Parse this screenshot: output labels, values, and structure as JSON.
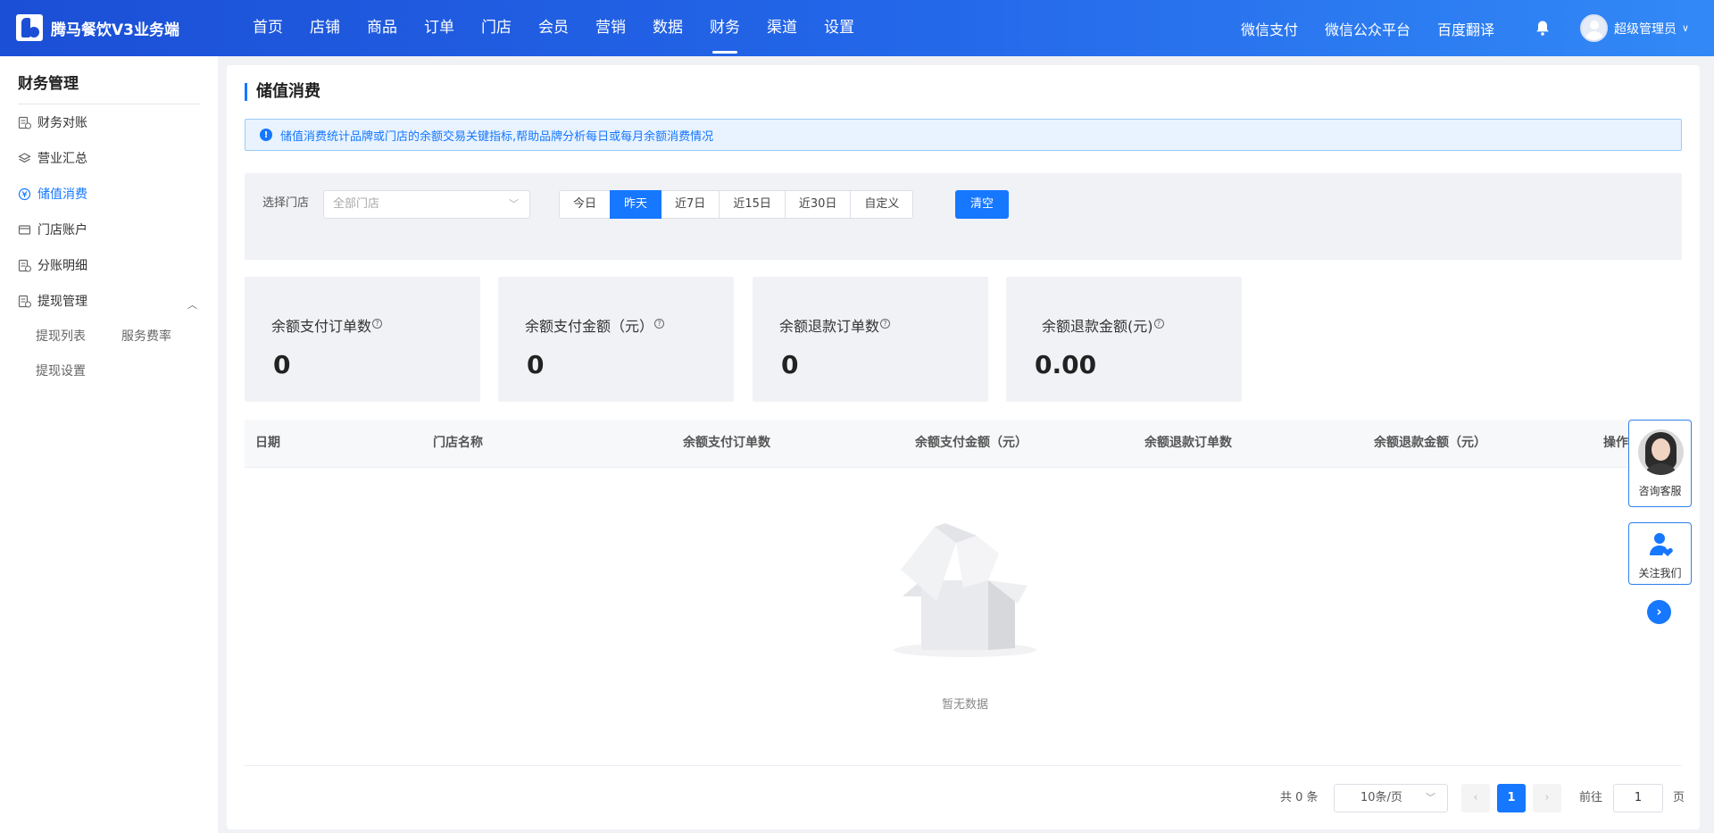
{
  "header": {
    "app_title": "腾马餐饮V3业务端",
    "nav": [
      "首页",
      "店铺",
      "商品",
      "订单",
      "门店",
      "会员",
      "营销",
      "数据",
      "财务",
      "渠道",
      "设置"
    ],
    "active_nav": "财务",
    "right_links": [
      "微信支付",
      "微信公众平台",
      "百度翻译"
    ],
    "user_name": "超级管理员",
    "user_caret": "∨"
  },
  "sidebar": {
    "title": "财务管理",
    "items": [
      {
        "label": "财务对账",
        "icon": "ledger-icon"
      },
      {
        "label": "营业汇总",
        "icon": "layers-icon"
      },
      {
        "label": "储值消费",
        "icon": "stored-value-icon",
        "active": true
      },
      {
        "label": "门店账户",
        "icon": "card-icon"
      },
      {
        "label": "分账明细",
        "icon": "ledger-icon"
      },
      {
        "label": "提现管理",
        "icon": "ledger-icon",
        "expanded": true
      }
    ],
    "sub_items": [
      "提现列表",
      "服务费率",
      "提现设置"
    ],
    "collapse_caret": "︿"
  },
  "page": {
    "title": "储值消费",
    "notice_icon": "!",
    "notice": "储值消费统计品牌或门店的余额交易关键指标,帮助品牌分析每日或每月余额消费情况"
  },
  "filter": {
    "store_label": "选择门店",
    "store_placeholder": "全部门店",
    "chevron": "﹀",
    "ranges": [
      "今日",
      "昨天",
      "近7日",
      "近15日",
      "近30日",
      "自定义"
    ],
    "active_range": "昨天",
    "clear_label": "清空"
  },
  "stats": [
    {
      "label": "余额支付订单数",
      "value": "0"
    },
    {
      "label": "余额支付金额（元）",
      "value": "0"
    },
    {
      "label": "余额退款订单数",
      "value": "0"
    },
    {
      "label": "余额退款金额(元)",
      "value": "0.00"
    }
  ],
  "help_mark": "?",
  "table": {
    "columns": [
      "日期",
      "门店名称",
      "余额支付订单数",
      "余额支付金额（元）",
      "余额退款订单数",
      "余额退款金额（元）",
      "操作"
    ],
    "rows": [],
    "empty_text": "暂无数据"
  },
  "pagination": {
    "total_text": "共 0 条",
    "page_size": "10条/页",
    "prev": "‹",
    "next": "›",
    "current_page": "1",
    "goto_label": "前往",
    "goto_value": "1",
    "page_suffix": "页"
  },
  "float_widgets": {
    "service_label": "咨询客服",
    "follow_label": "关注我们",
    "arrow": "›"
  },
  "colors": {
    "primary": "#1677ff",
    "header_start": "#1b4fd6",
    "header_end": "#3289f6",
    "notice_bg": "#e8f3ff"
  }
}
